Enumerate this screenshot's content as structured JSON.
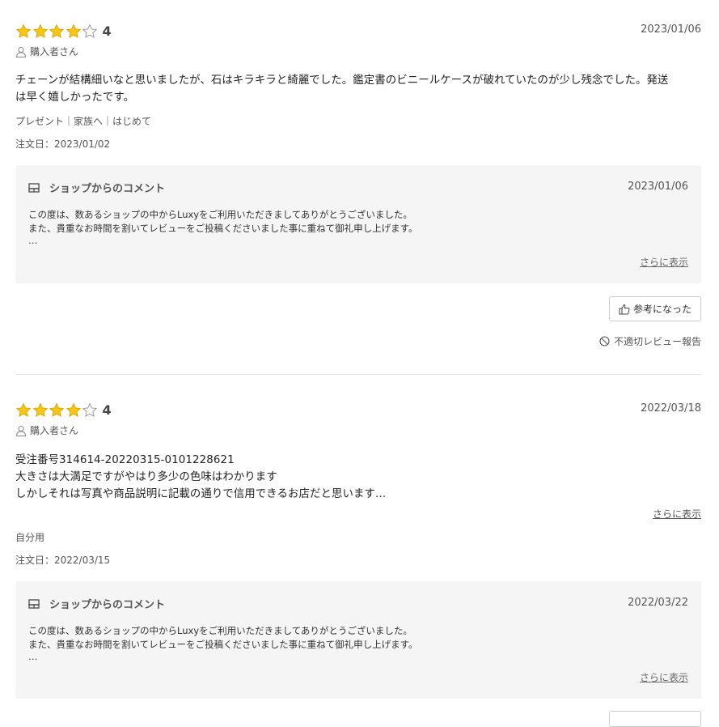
{
  "reviews": [
    {
      "rating": 4,
      "rating_label": "4",
      "date": "2023/01/06",
      "reviewer": "購入者さん",
      "body_lines": [
        "チェーンが結構細いなと思いましたが、石はキラキラと綺麗でした。鑑定書のビニールケースが破れていたのが少し残念でした。発送",
        "は早く嬉しかったです。"
      ],
      "tags": "プレゼント｜家族へ｜はじめて",
      "order_date": "注文日：2023/01/02",
      "shop_comment": {
        "title": "ショップからのコメント",
        "date": "2023/01/06",
        "lines": [
          "この度は、数あるショップの中からLuxyをご利用いただきましてありがとうございました。",
          "また、貴重なお時間を割いてレビューをご投稿くださいました事に重ねて御礼申し上げます。",
          "…"
        ],
        "more": "さらに表示"
      },
      "helpful_label": "参考になった",
      "report_label": "不適切レビュー報告"
    },
    {
      "rating": 4,
      "rating_label": "4",
      "date": "2022/03/18",
      "reviewer": "購入者さん",
      "body_lines": [
        "受注番号314614-20220315-0101228621",
        "大きさは大満足ですがやはり多少の色味はわかります",
        "しかしそれは写真や商品説明に記載の通りで信用できるお店だと思います…"
      ],
      "more": "さらに表示",
      "tags": "自分用",
      "order_date": "注文日：2022/03/15",
      "shop_comment": {
        "title": "ショップからのコメント",
        "date": "2022/03/22",
        "lines": [
          "この度は、数あるショップの中からLuxyをご利用いただきましてありがとうございました。",
          "また、貴重なお時間を割いてレビューをご投稿くださいました事に重ねて御礼申し上げます。",
          "…"
        ],
        "more": "さらに表示"
      }
    }
  ],
  "colors": {
    "star_fill": "#f5c518",
    "star_stroke": "#e0a800",
    "star_empty_stroke": "#999999",
    "shop_bg": "#f5f5f5"
  },
  "icons": {
    "star": "star-icon",
    "person": "person-icon",
    "shop": "shop-icon",
    "thumbs_up": "thumbs-up-icon",
    "prohibited": "prohibited-icon"
  }
}
